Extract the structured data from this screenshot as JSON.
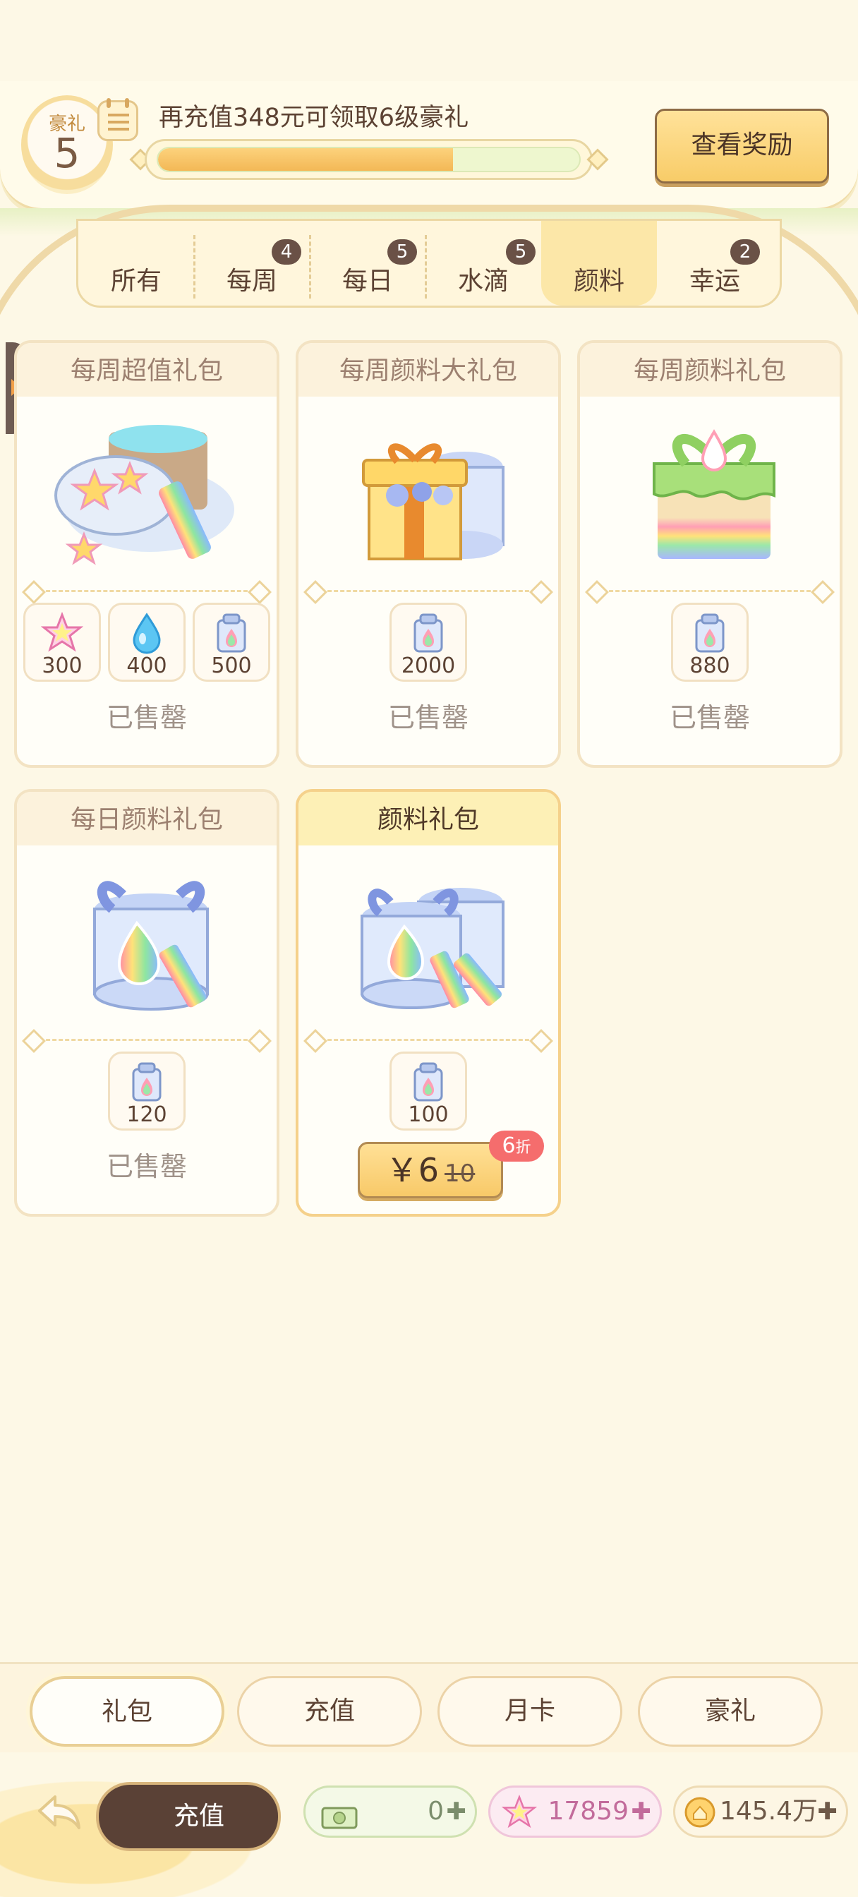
{
  "vip": {
    "badge_label": "豪礼",
    "level": "5",
    "message": "再充值348元可领取6级豪礼",
    "progress": 0.7,
    "rewards_button": "查看奖励"
  },
  "tabs": [
    {
      "label": "所有",
      "badge": ""
    },
    {
      "label": "每周",
      "badge": "4"
    },
    {
      "label": "每日",
      "badge": "5"
    },
    {
      "label": "水滴",
      "badge": "5"
    },
    {
      "label": "颜料",
      "badge": "",
      "active": true
    },
    {
      "label": "幸运",
      "badge": "2"
    }
  ],
  "cards": [
    {
      "title": "每周超值礼包",
      "items": [
        {
          "icon": "star-icon",
          "qty": "300"
        },
        {
          "icon": "water-drop-icon",
          "qty": "400"
        },
        {
          "icon": "paint-bag-icon",
          "qty": "500"
        }
      ],
      "status": "已售罄"
    },
    {
      "title": "每周颜料大礼包",
      "items": [
        {
          "icon": "paint-bag-icon",
          "qty": "2000"
        }
      ],
      "status": "已售罄"
    },
    {
      "title": "每周颜料礼包",
      "items": [
        {
          "icon": "paint-bag-icon",
          "qty": "880"
        }
      ],
      "status": "已售罄"
    },
    {
      "title": "每日颜料礼包",
      "items": [
        {
          "icon": "paint-bag-icon",
          "qty": "120"
        }
      ],
      "status": "已售罄"
    },
    {
      "title": "颜料礼包",
      "items": [
        {
          "icon": "paint-bag-icon",
          "qty": "100"
        }
      ],
      "price": "￥6",
      "original_price": "10",
      "discount": "6",
      "discount_unit": "折"
    }
  ],
  "bottom_tabs": [
    "礼包",
    "充值",
    "月卡",
    "豪礼"
  ],
  "footer": {
    "recharge_button": "充值",
    "currency_cash": "0",
    "currency_star": "17859",
    "currency_coin": "145.4万"
  },
  "colors": {
    "background": "#fdf8e6",
    "accent_gold": "#f8cc68",
    "dark_brown": "#5a4136",
    "discount_red": "#f56d6d"
  }
}
